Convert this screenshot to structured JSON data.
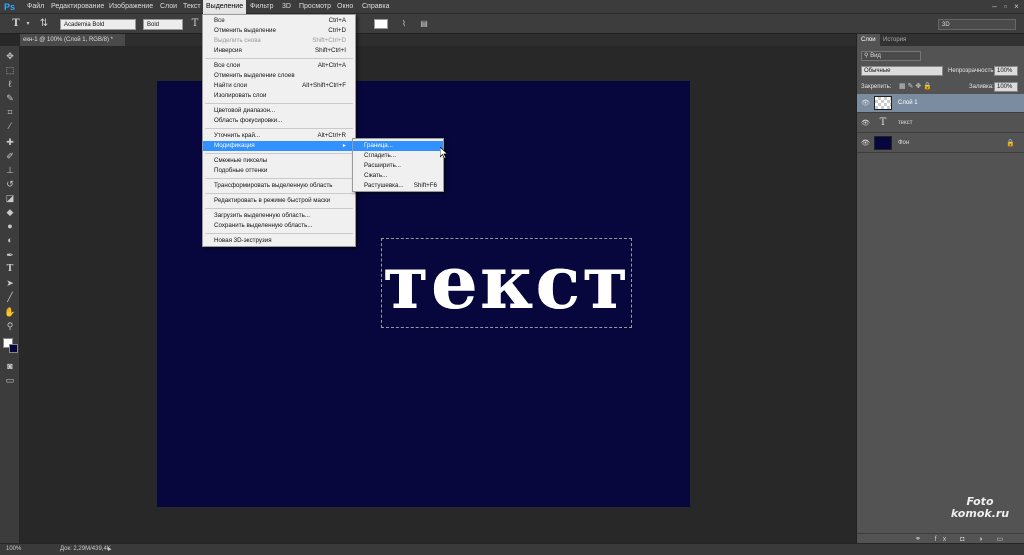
{
  "menubar": {
    "logo": "Ps",
    "items": [
      "Файл",
      "Редактирование",
      "Изображение",
      "Слои",
      "Текст",
      "Выделение",
      "Фильтр",
      "3D",
      "Просмотр",
      "Окно",
      "Справка"
    ],
    "active_index": 5
  },
  "options": {
    "font_family": "Academia Bold",
    "font_style": "Bold",
    "workspace": "3D"
  },
  "document": {
    "tab_title": "екн-1 @ 100% (Слой 1, RGB/8) *",
    "canvas_color": "#07073e",
    "canvas_text": "текст"
  },
  "select_menu": {
    "items": [
      {
        "label": "Все",
        "shortcut": "Ctrl+A",
        "disabled": false
      },
      {
        "label": "Отменить выделение",
        "shortcut": "Ctrl+D",
        "disabled": false
      },
      {
        "label": "Выделить снова",
        "shortcut": "Shift+Ctrl+D",
        "disabled": true
      },
      {
        "label": "Инверсия",
        "shortcut": "Shift+Ctrl+I",
        "disabled": false
      },
      {
        "sep": true
      },
      {
        "label": "Все слои",
        "shortcut": "Alt+Ctrl+A",
        "disabled": false
      },
      {
        "label": "Отменить выделение слоев",
        "shortcut": "",
        "disabled": false
      },
      {
        "label": "Найти слои",
        "shortcut": "Alt+Shift+Ctrl+F",
        "disabled": false
      },
      {
        "label": "Изолировать слои",
        "shortcut": "",
        "disabled": false
      },
      {
        "sep": true
      },
      {
        "label": "Цветовой диапазон...",
        "shortcut": "",
        "disabled": false
      },
      {
        "label": "Область фокусировки...",
        "shortcut": "",
        "disabled": false
      },
      {
        "sep": true
      },
      {
        "label": "Уточнить край...",
        "shortcut": "Alt+Ctrl+R",
        "disabled": false
      },
      {
        "label": "Модификация",
        "shortcut": "",
        "disabled": false,
        "highlight": true,
        "submenu": true
      },
      {
        "sep": true
      },
      {
        "label": "Смежные пикселы",
        "shortcut": "",
        "disabled": false
      },
      {
        "label": "Подобные оттенки",
        "shortcut": "",
        "disabled": false
      },
      {
        "sep": true
      },
      {
        "label": "Трансформировать выделенную область",
        "shortcut": "",
        "disabled": false
      },
      {
        "sep": true
      },
      {
        "label": "Редактировать в режиме быстрой маски",
        "shortcut": "",
        "disabled": false
      },
      {
        "sep": true
      },
      {
        "label": "Загрузить выделенную область...",
        "shortcut": "",
        "disabled": false
      },
      {
        "label": "Сохранить выделенную область...",
        "shortcut": "",
        "disabled": false
      },
      {
        "sep": true
      },
      {
        "label": "Новая 3D-экструзия",
        "shortcut": "",
        "disabled": false
      }
    ]
  },
  "modify_submenu": {
    "items": [
      {
        "label": "Граница...",
        "shortcut": "",
        "highlight": true
      },
      {
        "label": "Сгладить...",
        "shortcut": ""
      },
      {
        "label": "Расширить...",
        "shortcut": ""
      },
      {
        "label": "Сжать...",
        "shortcut": ""
      },
      {
        "label": "Растушевка...",
        "shortcut": "Shift+F6"
      }
    ]
  },
  "layers_panel": {
    "tabs": [
      "Слои",
      "История"
    ],
    "filter_label": "Вид",
    "blend_mode": "Обычные",
    "opacity_label": "Непрозрачность:",
    "opacity_value": "100%",
    "lock_label": "Закрепить:",
    "fill_label": "Заливка:",
    "fill_value": "100%",
    "layers": [
      {
        "name": "Слой 1",
        "type": "pixel",
        "selected": true
      },
      {
        "name": "текст",
        "type": "text",
        "selected": false
      },
      {
        "name": "Фон",
        "type": "background",
        "selected": false
      }
    ]
  },
  "status": {
    "zoom": "100%",
    "doc_info": "Док: 2,29M/439,4K"
  },
  "watermark": {
    "line1": "Foto",
    "line2": "komok.ru"
  }
}
